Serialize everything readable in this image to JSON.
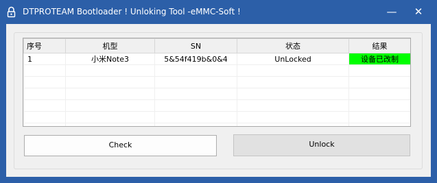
{
  "window": {
    "title": "DTPROTEAM Bootloader ! Unloking Tool -eMMC-Soft !",
    "minimize_glyph": "—",
    "close_glyph": "✕"
  },
  "table": {
    "headers": [
      "序号",
      "机型",
      "SN",
      "状态",
      "结果"
    ],
    "rows": [
      {
        "index": "1",
        "model": "小米Note3",
        "sn": "5&54f419b&0&4",
        "status": "UnLocked",
        "result": "设备已改制"
      }
    ]
  },
  "buttons": {
    "check": "Check",
    "unlock": "Unlock"
  },
  "colors": {
    "titlebar": "#2c5fa8",
    "result_ok": "#00ff00"
  },
  "icons": {
    "app": "lock-app-icon",
    "minimize": "minimize-icon",
    "close": "close-icon"
  }
}
